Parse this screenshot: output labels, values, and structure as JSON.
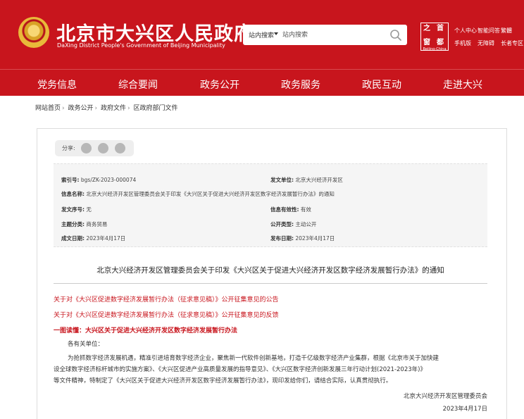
{
  "header": {
    "title": "北京市大兴区人民政府",
    "subtitle": "DaXing District People's Government of Beijing Municipality",
    "search": {
      "scope": "站内搜索",
      "placeholder": "站内搜索"
    },
    "toplinks": [
      "个人中心",
      "智能问答",
      "繁體",
      "手机版",
      "无障碍",
      "长者专区"
    ],
    "seal_glyphs": [
      "之",
      "首",
      "窗",
      "都"
    ],
    "seal_caption": "Beijing-China"
  },
  "nav": [
    "党务信息",
    "综合要闻",
    "政务公开",
    "政务服务",
    "政民互动",
    "走进大兴"
  ],
  "breadcrumb": [
    "网站首页",
    "政务公开",
    "政府文件",
    "区政府部门文件"
  ],
  "share": {
    "label": "分享:"
  },
  "meta": {
    "index_no_label": "索引号:",
    "index_no": "bgs/ZK-2023-000074",
    "issuer_label": "发文单位:",
    "issuer": "北京大兴经济开发区",
    "name_label": "信息名称:",
    "name": "北京大兴经济开发区管理委员会关于印发《大兴区关于促进大兴经济开发区数字经济发展暂行办法》的通知",
    "docno_label": "发文序号:",
    "docno": "无",
    "validity_label": "信息有效性:",
    "validity": "有效",
    "topic_label": "主题分类:",
    "topic": "商务贸易",
    "public_label": "公开类型:",
    "public": "主动公开",
    "date_label": "成文日期:",
    "date": "2023年4月17日",
    "pubdate_label": "发布日期:",
    "pubdate": "2023年4月17日"
  },
  "doc": {
    "title": "北京大兴经济开发区管理委员会关于印发《大兴区关于促进大兴经济开发区数字经济发展暂行办法》的通知",
    "links": [
      "关于对《大兴区促进数字经济发展暂行办法（征求意见稿）》公开征集意见的公告",
      "关于对《大兴区促进数字经济发展暂行办法（征求意见稿）》公开征集意见的反馈",
      "一图读懂：大兴区关于促进大兴经济开发区数字经济发展暂行办法"
    ],
    "salutation": "各有关单位：",
    "body_lines": [
      "为抢抓数字经济发展机遇，精准引进培育数字经济企业，聚焦新一代软件创新基地，打造千亿级数字经济产业集群，根据《北京市关于加快建",
      "设全球数字经济标杆城市的实施方案》、《大兴区促进产业高质量发展的指导意见》、《大兴区数字经济创新发展三年行动计划(2021-2023年)》",
      "等文件精神，特制定了《大兴区关于促进大兴经济开发区数字经济发展暂行办法》，现印发给你们，请结合实际，认真贯彻执行。"
    ],
    "signature": "北京大兴经济开发区管理委员会",
    "sign_date": "2023年4月17日"
  }
}
